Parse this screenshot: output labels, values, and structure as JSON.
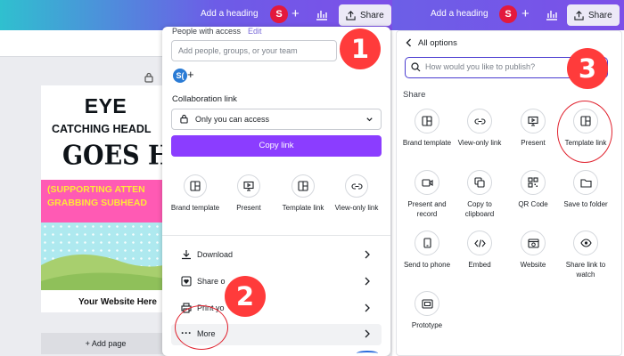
{
  "left_header": {
    "heading_link": "Add a heading",
    "avatar_initial": "S",
    "share_label": "Share"
  },
  "design": {
    "title_line1": "EYE",
    "title_line2": "CATCHING HEADL",
    "title_line3": "GOES HER",
    "sub_line1": "(SUPPORTING ATTEN",
    "sub_line2": "GRABBING SUBHEAD",
    "website": "Your Website Here",
    "add_page": "+ Add page"
  },
  "share_popover": {
    "people_label": "People with access",
    "edit_link": "Edit",
    "people_placeholder": "Add people, groups, or your team",
    "avatar_initial": "S(",
    "collab_label": "Collaboration link",
    "access_value": "Only you can access",
    "copy_link": "Copy link",
    "tiles": [
      {
        "icon": "brand-template-icon",
        "label": "Brand template"
      },
      {
        "icon": "present-icon",
        "label": "Present"
      },
      {
        "icon": "template-link-icon",
        "label": "Template link"
      },
      {
        "icon": "view-only-link-icon",
        "label": "View-only link"
      }
    ],
    "rows": [
      {
        "icon": "download-icon",
        "label": "Download"
      },
      {
        "icon": "heart-icon",
        "label": "Share o"
      },
      {
        "icon": "print-icon",
        "label": "Print yo"
      },
      {
        "icon": "more-icon",
        "label": "More"
      }
    ],
    "badge_1": "1",
    "badge_2": "2"
  },
  "right_header": {
    "heading_link": "Add a heading",
    "avatar_initial": "S",
    "share_label": "Share"
  },
  "all_options": {
    "title": "All options",
    "search_placeholder": "How would you like to publish?",
    "section": "Share",
    "badge_3": "3",
    "items": [
      {
        "icon": "brand-template-icon",
        "label": "Brand template"
      },
      {
        "icon": "view-only-link-icon",
        "label": "View-only link"
      },
      {
        "icon": "present-icon",
        "label": "Present"
      },
      {
        "icon": "template-link-icon",
        "label": "Template link"
      },
      {
        "icon": "present-and-record-icon",
        "label": "Present and record"
      },
      {
        "icon": "copy-to-clipboard-icon",
        "label": "Copy to clipboard"
      },
      {
        "icon": "qr-code-icon",
        "label": "QR Code"
      },
      {
        "icon": "folder-icon",
        "label": "Save to folder"
      },
      {
        "icon": "phone-icon",
        "label": "Send to phone"
      },
      {
        "icon": "embed-icon",
        "label": "Embed"
      },
      {
        "icon": "website-icon",
        "label": "Website"
      },
      {
        "icon": "eye-icon",
        "label": "Share link to watch"
      },
      {
        "icon": "prototype-icon",
        "label": "Prototype"
      }
    ]
  },
  "colors": {
    "accent": "#8b3dff",
    "badge": "#ff3b3b",
    "ring": "#e0232f"
  }
}
